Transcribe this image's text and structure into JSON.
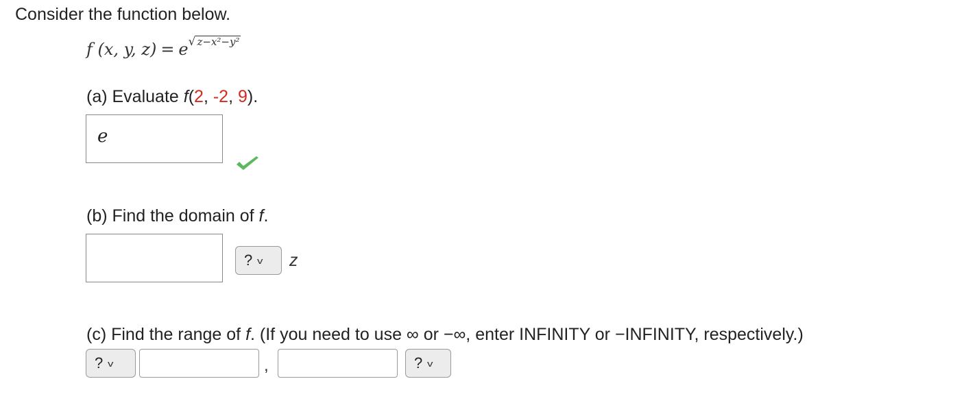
{
  "intro": "Consider the function below.",
  "formula": {
    "lhs": "f (x, y, z)",
    "eq": "=",
    "base": "e",
    "radical": "√",
    "radicand": "z−x²−y²"
  },
  "part_a": {
    "prefix": "(a) Evaluate ",
    "f": "f",
    "open": "(",
    "arg1": "2",
    "sep1": ", ",
    "arg2": "-2",
    "sep2": ", ",
    "arg3": "9",
    "close": ").",
    "answer": "e",
    "status_icon": "checkmark-icon",
    "status_color": "#5cb85c"
  },
  "part_b": {
    "prefix": "(b) Find the domain of ",
    "f": "f",
    "suffix": ".",
    "answer": "",
    "select_value": "?",
    "chevron": "v",
    "variable": "z"
  },
  "part_c": {
    "prefix": "(c) Find the range of ",
    "f": "f",
    "suffix": ". (If you need to use ∞ or −∞, enter INFINITY or −INFINITY, respectively.)",
    "left_select_value": "?",
    "left_answer": "",
    "comma": ",",
    "right_answer": "",
    "right_select_value": "?",
    "chevron": "v"
  },
  "colors": {
    "highlight_red": "#d52b1e",
    "select_bg": "#ececec"
  }
}
